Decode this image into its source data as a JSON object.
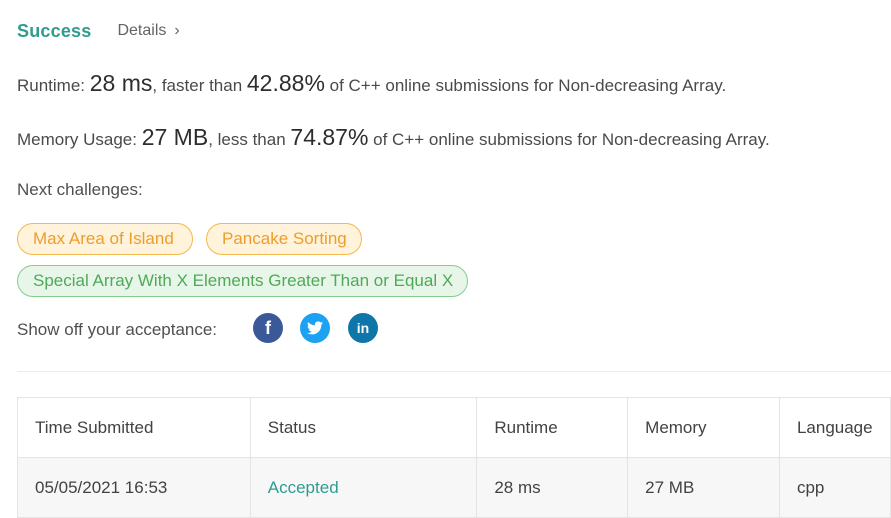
{
  "header": {
    "status": "Success",
    "details_label": "Details",
    "details_chevron": "›"
  },
  "runtime": {
    "label": "Runtime: ",
    "value": "28 ms",
    "compare_text": ", faster than ",
    "percent": "42.88%",
    "suffix": " of C++ online submissions for Non-decreasing Array."
  },
  "memory": {
    "label": "Memory Usage: ",
    "value": "27 MB",
    "compare_text": ", less than ",
    "percent": "74.87%",
    "suffix": " of C++ online submissions for Non-decreasing Array."
  },
  "next_challenges": {
    "label": "Next challenges:",
    "items": [
      {
        "title": "Max Area of Island",
        "difficulty": "medium"
      },
      {
        "title": "Pancake Sorting",
        "difficulty": "medium"
      },
      {
        "title": "Special Array With X Elements Greater Than or Equal X",
        "difficulty": "easy"
      }
    ]
  },
  "share": {
    "label": "Show off your acceptance:",
    "icons": [
      "facebook-icon",
      "twitter-icon",
      "linkedin-icon"
    ],
    "facebook_glyph": "f",
    "linkedin_glyph": "in"
  },
  "colors": {
    "success": "#2f9c8e",
    "medium_chip_text": "#ef9d2a",
    "easy_chip_text": "#4eaa57",
    "facebook": "#3b5998",
    "twitter": "#1da1f2",
    "linkedin": "#0e76a8"
  },
  "table": {
    "headers": [
      "Time Submitted",
      "Status",
      "Runtime",
      "Memory",
      "Language"
    ],
    "rows": [
      [
        "05/05/2021 16:53",
        "Accepted",
        "28 ms",
        "27 MB",
        "cpp"
      ]
    ]
  }
}
